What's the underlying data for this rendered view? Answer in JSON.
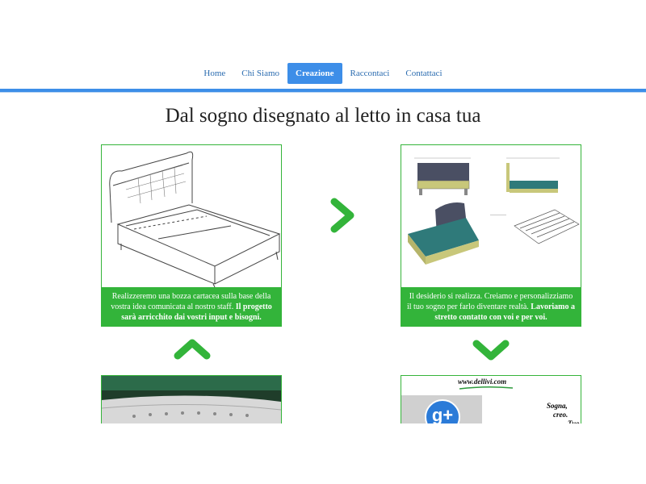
{
  "nav": {
    "items": [
      {
        "label": "Home"
      },
      {
        "label": "Chi Siamo"
      },
      {
        "label": "Creazione"
      },
      {
        "label": "Raccontaci"
      },
      {
        "label": "Contattaci"
      }
    ],
    "active_index": 2
  },
  "main": {
    "heading": "Dal sogno disegnato al letto in casa tua",
    "step1": {
      "text": "Realizzeremo una bozza cartacea sulla base della vostra idea comunicata al nostro staff.",
      "bold": "Il progetto sarà arricchito dai vostri input e bisogni."
    },
    "step2": {
      "text": "Il desiderio si realizza. Creiamo e personalizziamo il tuo sogno per farlo diventare realtà.",
      "bold": "Lavoriamo a stretto contatto con voi e per voi."
    },
    "step4": {
      "url": "www.dellivi.com",
      "slogan_1": "Sogna,",
      "slogan_2": "creo.",
      "slogan_3": "Tuo"
    }
  },
  "colors": {
    "accent_blue": "#3d8ee8",
    "green": "#33b43a"
  }
}
